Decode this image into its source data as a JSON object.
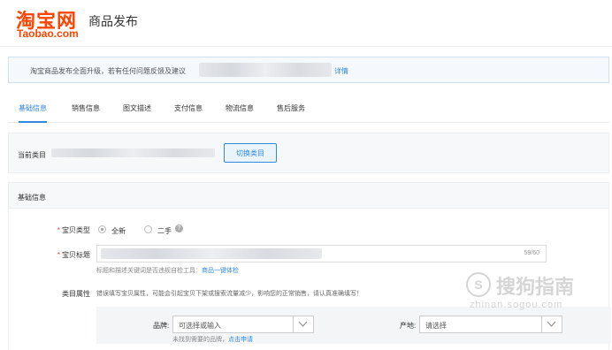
{
  "header": {
    "logo_cn": "淘宝网",
    "logo_en": "Taobao.com",
    "page_title": "商品发布"
  },
  "notice": {
    "text": "淘宝商品发布全面升级，若有任何问题反馈及建议",
    "link": "详情"
  },
  "tabs": [
    {
      "label": "基础信息",
      "active": true
    },
    {
      "label": "销售信息",
      "active": false
    },
    {
      "label": "图文描述",
      "active": false
    },
    {
      "label": "支付信息",
      "active": false
    },
    {
      "label": "物流信息",
      "active": false
    },
    {
      "label": "售后服务",
      "active": false
    }
  ],
  "category": {
    "label": "当前类目",
    "switch_button": "切换类目"
  },
  "basic_info": {
    "section_title": "基础信息",
    "item_type": {
      "label": "宝贝类型",
      "options": [
        {
          "label": "全新",
          "checked": true
        },
        {
          "label": "二手",
          "checked": false
        }
      ]
    },
    "item_title": {
      "label": "宝贝标题",
      "counter": "59/60",
      "hint_text": "标题和描述关键词是否违规自检工具：",
      "hint_link": "商品一键体检"
    },
    "attributes": {
      "label": "类目属性",
      "warning": "错误填写宝贝属性，可能会引起宝贝下架或搜索流量减少，影响您的正常销售，请认真准确填写！",
      "brand": {
        "label": "品牌:",
        "placeholder": "可选择或输入",
        "hint_text": "未找到需要的品牌，",
        "hint_link": "点击申请"
      },
      "origin": {
        "label": "产地:",
        "placeholder": "请选择"
      }
    }
  },
  "watermark": {
    "text_cn": "搜狗指南",
    "text_en": "zhinan.sogou.com"
  },
  "colors": {
    "brand_orange": "#ff4400",
    "link_blue": "#3089dc",
    "required_red": "#ff3333"
  }
}
